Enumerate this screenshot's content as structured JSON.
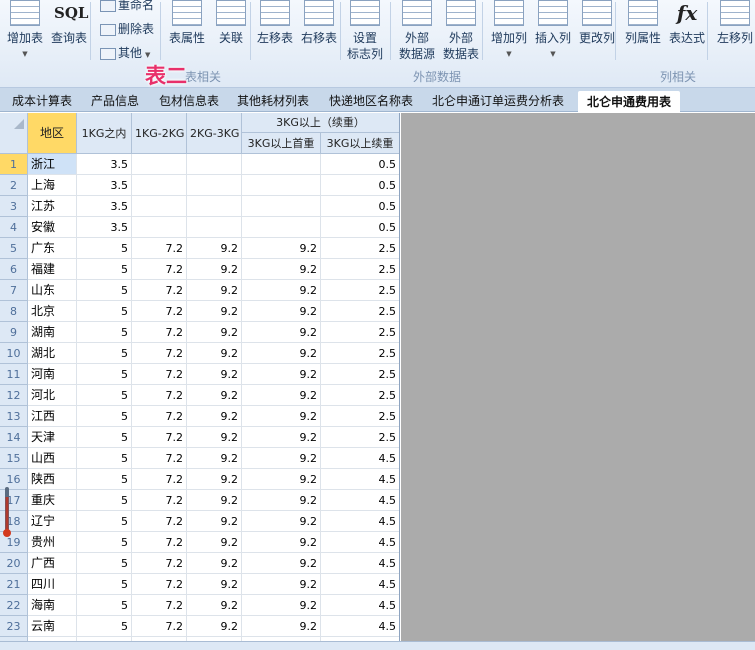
{
  "ribbon": {
    "buttons": [
      {
        "label": "增加表",
        "dropdown": true,
        "icon": "table-add-icon"
      },
      {
        "label": "查询表",
        "icon": "sql-icon",
        "text": "SQL"
      },
      {
        "label": "表属性",
        "icon": "table-properties-icon"
      },
      {
        "label": "关联",
        "icon": "relation-icon"
      },
      {
        "label": "左移表",
        "icon": "move-left-icon"
      },
      {
        "label": "右移表",
        "icon": "move-right-icon"
      },
      {
        "label": "设置\n标志列",
        "icon": "flag-column-icon"
      },
      {
        "label": "外部\n数据源",
        "icon": "external-source-icon"
      },
      {
        "label": "外部\n数据表",
        "icon": "external-table-icon"
      },
      {
        "label": "增加列",
        "dropdown": true,
        "icon": "column-add-icon"
      },
      {
        "label": "插入列",
        "dropdown": true,
        "icon": "column-insert-icon"
      },
      {
        "label": "更改列",
        "icon": "column-edit-icon"
      },
      {
        "label": "列属性",
        "icon": "column-properties-icon"
      },
      {
        "label": "表达式",
        "icon": "fx-icon",
        "text": "fx"
      },
      {
        "label": "左移列",
        "icon": "column-move-left-icon"
      }
    ],
    "small": [
      {
        "label": "重命名"
      },
      {
        "label": "删除表"
      },
      {
        "label": "其他"
      }
    ],
    "groups": [
      "表相关",
      "外部数据",
      "列相关"
    ],
    "annotation": "表二"
  },
  "tabs": [
    "成本计算表",
    "产品信息",
    "包材信息表",
    "其他耗材列表",
    "快递地区名称表",
    "北仑申通订单运费分析表",
    "北仑申通费用表"
  ],
  "active_tab": "北仑申通费用表",
  "grid": {
    "headers": {
      "region": "地区",
      "c1": "1KG之内",
      "c2": "1KG-2KG",
      "c3": "2KG-3KG",
      "group": "3KG以上（续重）",
      "c4": "3KG以上首重",
      "c5": "3KG以上续重"
    },
    "rows": [
      [
        "1",
        "浙江",
        "3.5",
        "",
        "",
        "",
        "0.5"
      ],
      [
        "2",
        "上海",
        "3.5",
        "",
        "",
        "",
        "0.5"
      ],
      [
        "3",
        "江苏",
        "3.5",
        "",
        "",
        "",
        "0.5"
      ],
      [
        "4",
        "安徽",
        "3.5",
        "",
        "",
        "",
        "0.5"
      ],
      [
        "5",
        "广东",
        "5",
        "7.2",
        "9.2",
        "9.2",
        "2.5"
      ],
      [
        "6",
        "福建",
        "5",
        "7.2",
        "9.2",
        "9.2",
        "2.5"
      ],
      [
        "7",
        "山东",
        "5",
        "7.2",
        "9.2",
        "9.2",
        "2.5"
      ],
      [
        "8",
        "北京",
        "5",
        "7.2",
        "9.2",
        "9.2",
        "2.5"
      ],
      [
        "9",
        "湖南",
        "5",
        "7.2",
        "9.2",
        "9.2",
        "2.5"
      ],
      [
        "10",
        "湖北",
        "5",
        "7.2",
        "9.2",
        "9.2",
        "2.5"
      ],
      [
        "11",
        "河南",
        "5",
        "7.2",
        "9.2",
        "9.2",
        "2.5"
      ],
      [
        "12",
        "河北",
        "5",
        "7.2",
        "9.2",
        "9.2",
        "2.5"
      ],
      [
        "13",
        "江西",
        "5",
        "7.2",
        "9.2",
        "9.2",
        "2.5"
      ],
      [
        "14",
        "天津",
        "5",
        "7.2",
        "9.2",
        "9.2",
        "2.5"
      ],
      [
        "15",
        "山西",
        "5",
        "7.2",
        "9.2",
        "9.2",
        "4.5"
      ],
      [
        "16",
        "陕西",
        "5",
        "7.2",
        "9.2",
        "9.2",
        "4.5"
      ],
      [
        "17",
        "重庆",
        "5",
        "7.2",
        "9.2",
        "9.2",
        "4.5"
      ],
      [
        "18",
        "辽宁",
        "5",
        "7.2",
        "9.2",
        "9.2",
        "4.5"
      ],
      [
        "19",
        "贵州",
        "5",
        "7.2",
        "9.2",
        "9.2",
        "4.5"
      ],
      [
        "20",
        "广西",
        "5",
        "7.2",
        "9.2",
        "9.2",
        "4.5"
      ],
      [
        "21",
        "四川",
        "5",
        "7.2",
        "9.2",
        "9.2",
        "4.5"
      ],
      [
        "22",
        "海南",
        "5",
        "7.2",
        "9.2",
        "9.2",
        "4.5"
      ],
      [
        "23",
        "云南",
        "5",
        "7.2",
        "9.2",
        "9.2",
        "4.5"
      ]
    ]
  },
  "colors": {
    "selected_header": "#ffd966",
    "selected_cell": "#cfe2f7",
    "annotation": "#e8306a"
  }
}
